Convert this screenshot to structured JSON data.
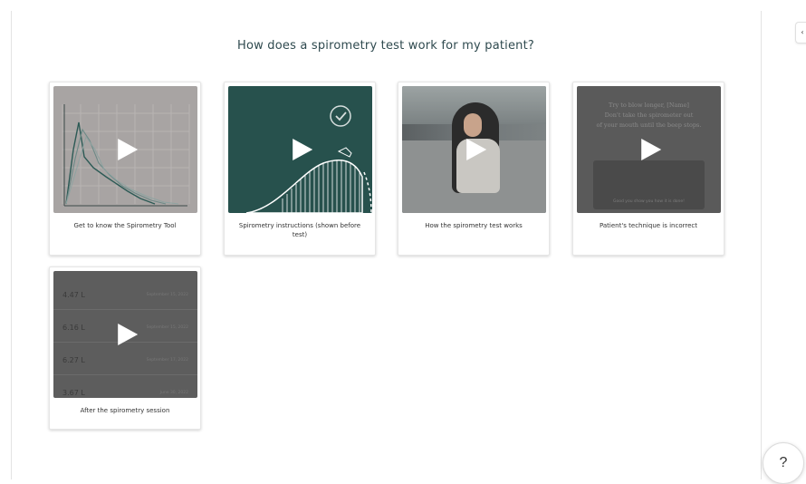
{
  "page": {
    "title": "How does a spirometry test work for my patient?"
  },
  "cards": [
    {
      "caption": "Get to know the Spirometry Tool",
      "thumb": "graph"
    },
    {
      "caption": "Spirometry instructions (shown before test)",
      "thumb": "teal-illustration"
    },
    {
      "caption": "How the spirometry test works",
      "thumb": "photo"
    },
    {
      "caption": "Patient's technique is incorrect",
      "thumb": "text-overlay"
    },
    {
      "caption": "After the spirometry session",
      "thumb": "results-list"
    }
  ],
  "thumb_overlay": {
    "lines": [
      "Try to blow longer, [Name]",
      "Don't take the spirometer out",
      "of your mouth until the beep stops."
    ],
    "inner_caption": "Good you show you how it is done!"
  },
  "results_list": [
    {
      "value": "4.47 L",
      "date": "September 15, 2022"
    },
    {
      "value": "6.16 L",
      "date": "September 15, 2022"
    },
    {
      "value": "6.27 L",
      "date": "September 17, 2022"
    },
    {
      "value": "3.67 L",
      "date": "June 30, 2022"
    }
  ],
  "help": {
    "label": "?"
  },
  "side_tab": {
    "label": "‹"
  },
  "colors": {
    "title": "#2f4a4f",
    "teal": "#27514d",
    "graph_bg": "#a8a4a3"
  },
  "icons": [
    "play-icon",
    "check-circle-icon",
    "help-icon",
    "collapse-icon"
  ]
}
